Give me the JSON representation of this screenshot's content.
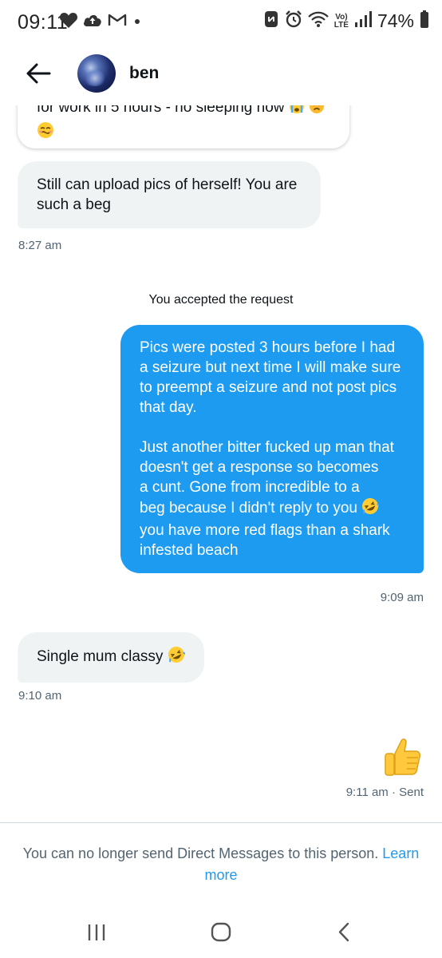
{
  "status_bar": {
    "time": "09:11",
    "battery": "74%",
    "left_icons": [
      "heart-icon",
      "cloud-upload-icon",
      "gmail-icon",
      "dot-icon"
    ],
    "right_icons": [
      "nfc-icon",
      "alarm-icon",
      "wifi-icon",
      "volte-icon",
      "signal-icon",
      "battery-icon"
    ],
    "volte_label": "Vo)",
    "lte_label": "LTE"
  },
  "header": {
    "contact_name": "ben"
  },
  "messages": {
    "partial_top_line": "for work in 5 hours - no sleeping now",
    "partial_top_emojis": [
      "crying-emoji",
      "frowning-emoji",
      "woozy-emoji"
    ],
    "received_1": {
      "line1": "Still can upload pics of herself! You are",
      "line2": "such a beg",
      "time": "8:27 am"
    },
    "system_note": "You accepted the request",
    "sent_1": {
      "lines": [
        "Pics were posted 3 hours before I had",
        "a seizure but next time I will make sure",
        "to preempt a seizure and not post pics",
        "that day.",
        "",
        "Just another bitter fucked up man that",
        "doesn't get a response so becomes",
        "a cunt. Gone from incredible to a",
        "beg because I didn't reply to you",
        "you have more red flags than a shark",
        "infested beach"
      ],
      "time": "9:09 am"
    },
    "received_2": {
      "text": "Single mum classy",
      "time": "9:10 am"
    },
    "sent_2": {
      "emoji": "thumbs-up-emoji",
      "time": "9:11 am · Sent"
    }
  },
  "footer": {
    "notice_text": "You can no longer send Direct Messages to this person.",
    "learn_more": "Learn more"
  },
  "colors": {
    "accent": "#1d9bf0",
    "received_bubble": "#eff3f4",
    "secondary_text": "#536471"
  }
}
